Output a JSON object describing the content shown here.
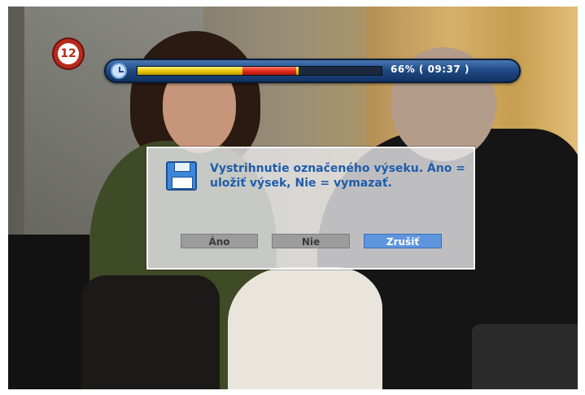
{
  "channel": {
    "number": "12"
  },
  "playback": {
    "progress_text": "66% ( 09:37 )",
    "progress_fraction": 0.66,
    "marked_segment": {
      "start_fraction": 0.43,
      "end_fraction": 0.65
    },
    "colors": {
      "played": "#e8c500",
      "marked": "#e02a18",
      "bar": "#214c88"
    }
  },
  "dialog": {
    "message": "Vystrihnutie označeného výseku. Áno = uložiť výsek, Nie = vymazať.",
    "buttons": {
      "yes": "Áno",
      "no": "Nie",
      "cancel": "Zrušiť"
    },
    "focused_button": "cancel",
    "accent_color": "#5e95dc",
    "text_color": "#1f5dab"
  }
}
